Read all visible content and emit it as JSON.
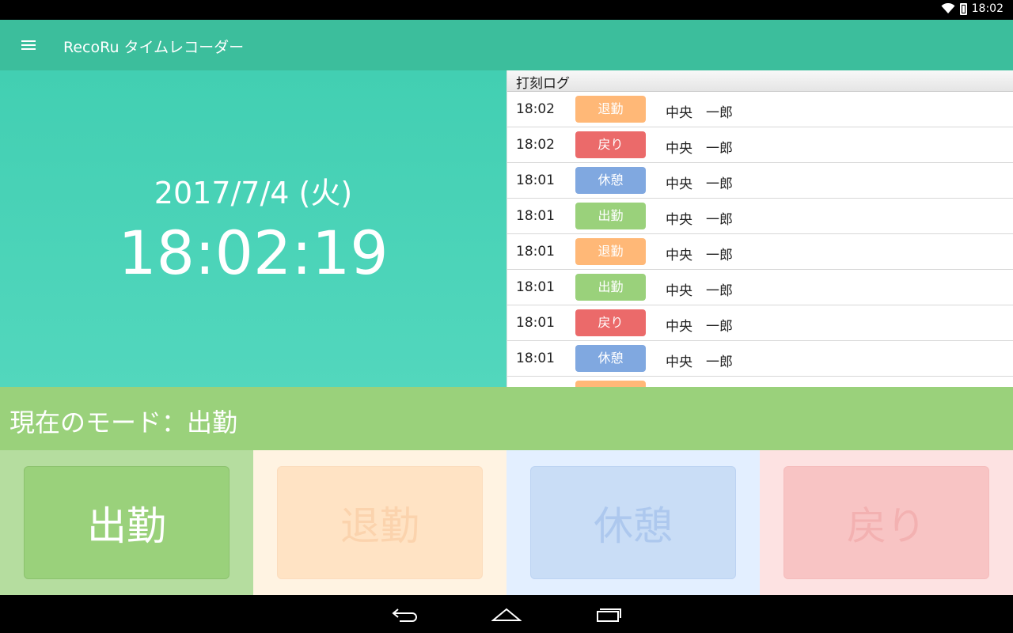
{
  "status_bar": {
    "time": "18:02"
  },
  "app_bar": {
    "title": "RecoRu タイムレコーダー"
  },
  "clock": {
    "date": "2017/7/4 (火)",
    "time": "18:02:19"
  },
  "log": {
    "header": "打刻ログ",
    "rows": [
      {
        "time": "18:02",
        "type": "退勤",
        "name": "中央　一郎"
      },
      {
        "time": "18:02",
        "type": "戻り",
        "name": "中央　一郎"
      },
      {
        "time": "18:01",
        "type": "休憩",
        "name": "中央　一郎"
      },
      {
        "time": "18:01",
        "type": "出勤",
        "name": "中央　一郎"
      },
      {
        "time": "18:01",
        "type": "退勤",
        "name": "中央　一郎"
      },
      {
        "time": "18:01",
        "type": "出勤",
        "name": "中央　一郎"
      },
      {
        "time": "18:01",
        "type": "戻り",
        "name": "中央　一郎"
      },
      {
        "time": "18:01",
        "type": "休憩",
        "name": "中央　一郎"
      }
    ]
  },
  "mode": {
    "current_label": "現在のモード：出勤"
  },
  "mode_buttons": [
    {
      "label": "出勤",
      "active": true
    },
    {
      "label": "退勤",
      "active": false
    },
    {
      "label": "休憩",
      "active": false
    },
    {
      "label": "戻り",
      "active": false
    }
  ],
  "colors": {
    "app_bar": "#3cbe9c",
    "clock_panel": "#48d2b6",
    "mode_bar": "#9ad17b",
    "clock_in": "#9ad17b",
    "clock_out": "#ffb877",
    "break": "#80a8e0",
    "return": "#eb6a6a"
  },
  "icons": [
    "menu-icon",
    "wifi-icon",
    "battery-icon",
    "back-icon",
    "home-icon",
    "recent-apps-icon"
  ]
}
